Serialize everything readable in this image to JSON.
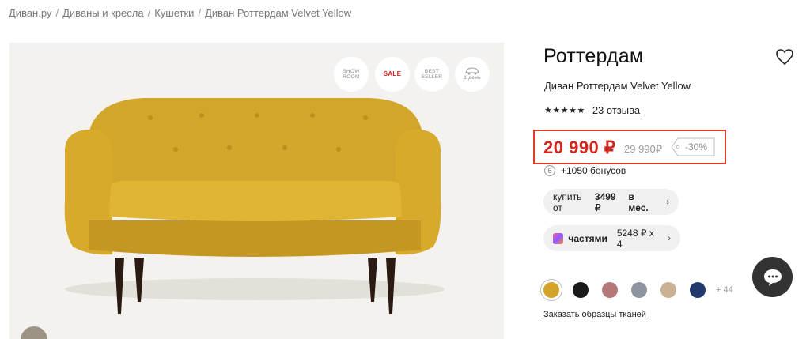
{
  "breadcrumb": {
    "items": [
      "Диван.ру",
      "Диваны и кресла",
      "Кушетки",
      "Диван Роттердам Velvet Yellow"
    ],
    "separator": "/"
  },
  "badges": {
    "showroom": "SHOW ROOM",
    "sale": "SALE",
    "bestseller": "BEST SELLER",
    "delivery": "1 день"
  },
  "product": {
    "title": "Роттердам",
    "subtitle": "Диван Роттердам Velvet Yellow",
    "stars": "★★★★★",
    "reviews": "23 отзыва",
    "price": "20 990 ₽",
    "old_price": "29 990₽",
    "discount": "-30%",
    "bonus_icon": "6",
    "bonus": "+1050 бонусов"
  },
  "installment": {
    "prefix": "купить от",
    "amount": "3499 ₽",
    "suffix": "в мес."
  },
  "parts": {
    "name": "частями",
    "value": "5248 ₽ x 4"
  },
  "swatches": {
    "colors": [
      "#d4a42a",
      "#1a1a1a",
      "#b57878",
      "#8e95a0",
      "#cbb193",
      "#1f3a6b"
    ],
    "more": "+ 44"
  },
  "samples_link": "Заказать образцы тканей",
  "colors": {
    "accent": "#d4261a",
    "highlight": "#e03a2a"
  }
}
